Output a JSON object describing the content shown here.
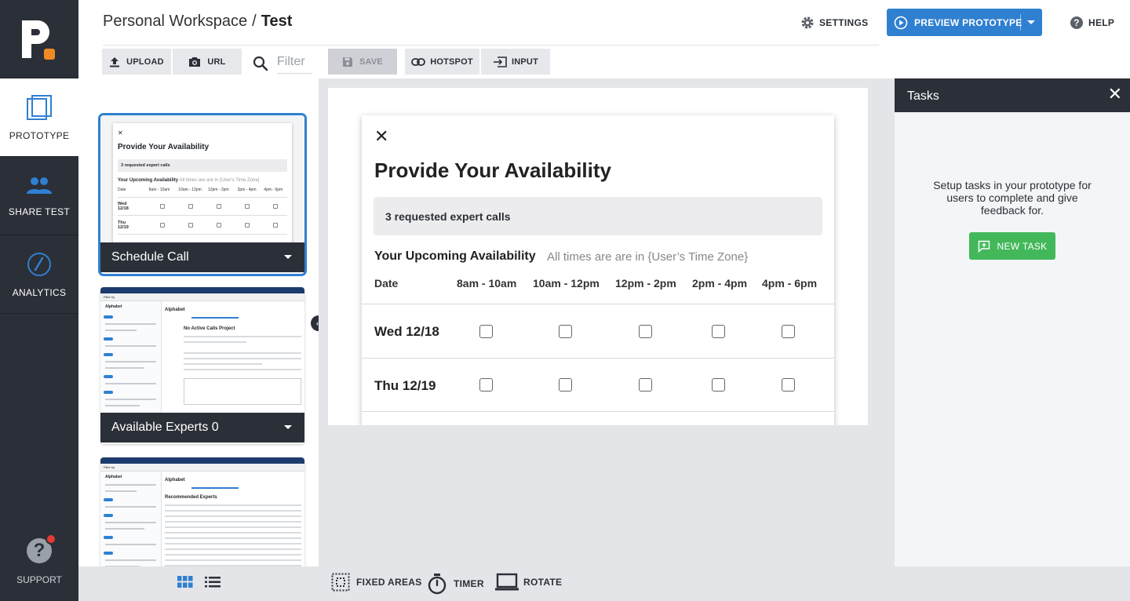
{
  "nav": {
    "items": [
      {
        "label": "PROTOTYPE",
        "icon": "prototype-icon"
      },
      {
        "label": "SHARE TEST",
        "icon": "people-icon"
      },
      {
        "label": "ANALYTICS",
        "icon": "gauge-icon"
      }
    ],
    "support_label": "SUPPORT"
  },
  "header": {
    "workspace": "Personal Workspace",
    "separator": "/",
    "project": "Test",
    "settings_label": "SETTINGS",
    "preview_label": "PREVIEW PROTOTYPE",
    "help_label": "HELP"
  },
  "toolbar": {
    "upload_label": "UPLOAD",
    "url_label": "URL",
    "filter_placeholder": "Filter",
    "save_label": "SAVE",
    "hotspot_label": "HOTSPOT",
    "input_label": "INPUT"
  },
  "screens": [
    {
      "name": "Schedule Call",
      "selected": true
    },
    {
      "name": "Available Experts 0",
      "selected": false
    }
  ],
  "mini_schedule": {
    "title": "Provide Your Availability",
    "requested": "3 requested expert calls",
    "upcoming": "Your Upcoming Availability",
    "upcoming_sub": "All times are are in {User's Time Zone}",
    "date_header": "Date",
    "slots": [
      "8am - 10am",
      "10am - 12pm",
      "12pm - 2pm",
      "2pm - 4pm",
      "4pm - 6pm"
    ],
    "days": [
      "Wed 12/18",
      "Thu 12/19"
    ]
  },
  "mini_app": {
    "filter_by": "Filter by",
    "section": "Alphabet",
    "heading_a": "No Active Calls Project",
    "heading_b": "Recommended Experts"
  },
  "modal": {
    "title": "Provide Your Availability",
    "requested": "3 requested expert calls",
    "upcoming": "Your Upcoming Availability",
    "upcoming_sub": "All times are are in {User’s Time Zone}",
    "date_header": "Date",
    "slots": [
      "8am - 10am",
      "10am - 12pm",
      "12pm - 2pm",
      "2pm - 4pm",
      "4pm - 6pm"
    ],
    "days": [
      "Wed 12/18",
      "Thu 12/19"
    ]
  },
  "tasks": {
    "title": "Tasks",
    "message": "Setup tasks in your prototype for users to complete and give feedback for.",
    "new_task_label": "NEW TASK"
  },
  "bottom": {
    "fixed_areas_label": "FIXED AREAS",
    "timer_label": "TIMER",
    "rotate_label": "ROTATE"
  },
  "colors": {
    "accent": "#2f80d1",
    "nav_bg": "#2b2f37",
    "success": "#43b85a",
    "logo_dot": "#f08a24"
  }
}
